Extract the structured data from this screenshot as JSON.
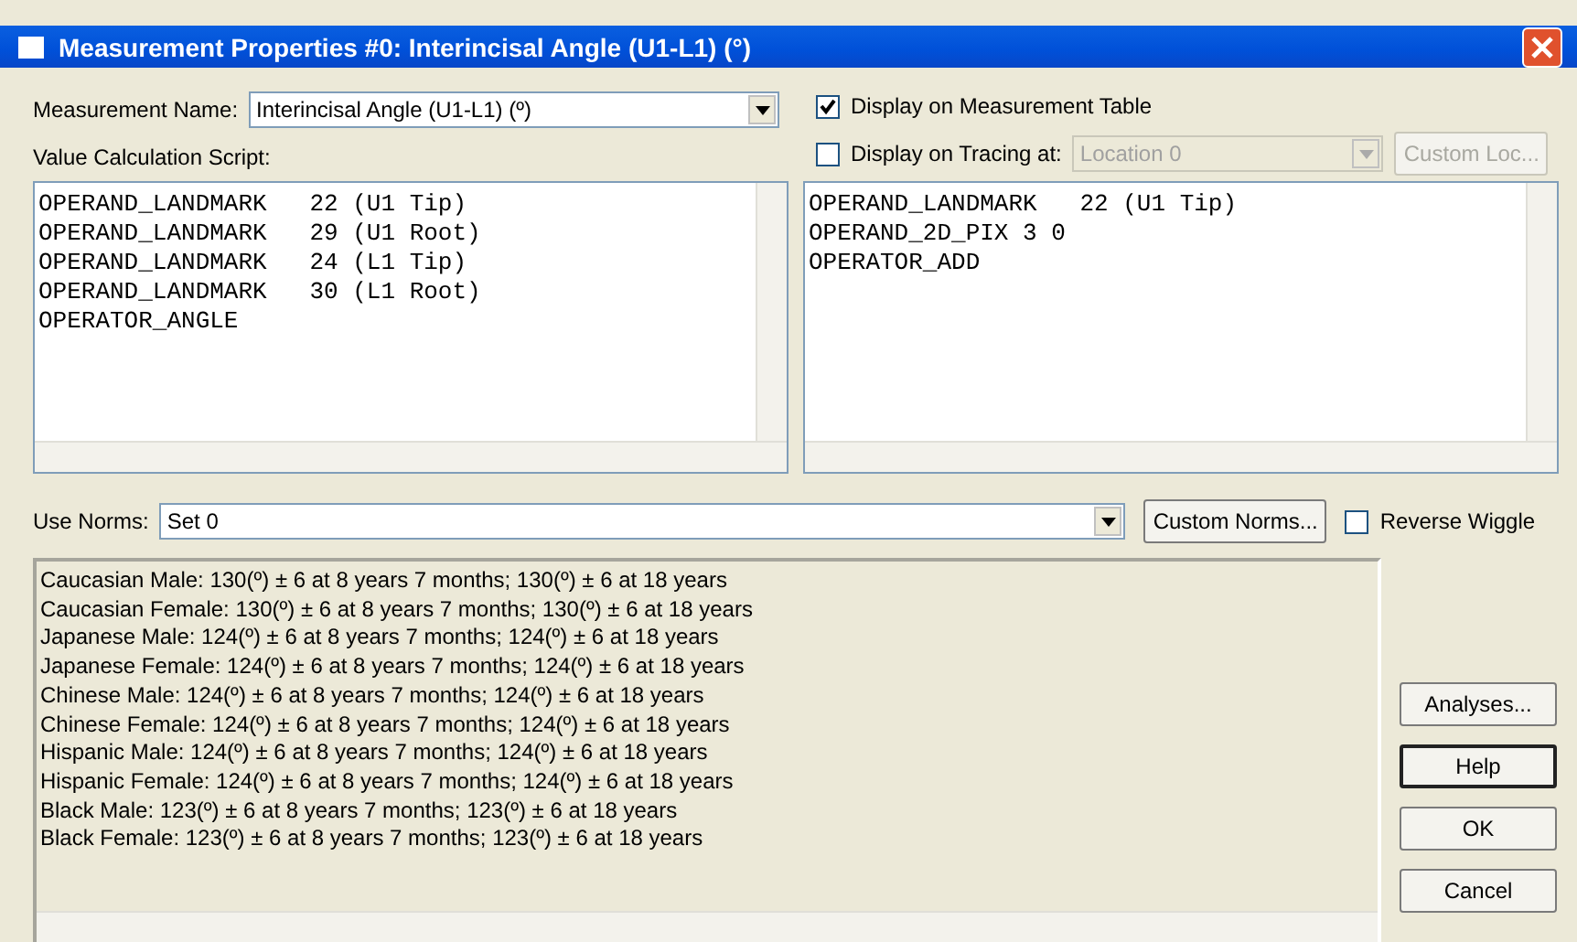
{
  "window": {
    "title": "Measurement Properties #0: Interincisal Angle (U1-L1) (°)"
  },
  "measurement_name": {
    "label": "Measurement Name:",
    "value": "Interincisal Angle (U1-L1) (º)"
  },
  "display_on_table": {
    "label": "Display on Measurement Table",
    "checked": true
  },
  "display_on_tracing": {
    "label": "Display on Tracing at:",
    "checked": false,
    "location": "Location 0",
    "location_disabled": true,
    "custom_button": "Custom Loc...",
    "custom_disabled": true
  },
  "script_label": "Value Calculation Script:",
  "script_left": [
    "OPERAND_LANDMARK   22 (U1 Tip)",
    "OPERAND_LANDMARK   29 (U1 Root)",
    "OPERAND_LANDMARK   24 (L1 Tip)",
    "OPERAND_LANDMARK   30 (L1 Root)",
    "OPERATOR_ANGLE"
  ],
  "script_right": [
    "OPERAND_LANDMARK   22 (U1 Tip)",
    "OPERAND_2D_PIX 3 0",
    "OPERATOR_ADD"
  ],
  "norms": {
    "label": "Use Norms:",
    "value": "Set 0",
    "custom_button": "Custom Norms...",
    "reverse_wiggle": {
      "label": "Reverse Wiggle",
      "checked": false
    }
  },
  "norm_lines": [
    "Caucasian Male: 130(º) ± 6 at 8 years 7 months; 130(º) ± 6 at 18 years",
    "Caucasian Female: 130(º) ± 6 at 8 years 7 months; 130(º) ± 6 at 18 years",
    "Japanese Male: 124(º) ± 6 at 8 years 7 months; 124(º) ± 6 at 18 years",
    "Japanese Female: 124(º) ± 6 at 8 years 7 months; 124(º) ± 6 at 18 years",
    "Chinese Male: 124(º) ± 6 at 8 years 7 months; 124(º) ± 6 at 18 years",
    "Chinese Female: 124(º) ± 6 at 8 years 7 months; 124(º) ± 6 at 18 years",
    "Hispanic Male: 124(º) ± 6 at 8 years 7 months; 124(º) ± 6 at 18 years",
    "Hispanic Female: 124(º) ± 6 at 8 years 7 months; 124(º) ± 6 at 18 years",
    "Black Male: 123(º) ± 6 at 8 years 7 months; 123(º) ± 6 at 18 years",
    "Black Female: 123(º) ± 6 at 8 years 7 months; 123(º) ± 6 at 18 years"
  ],
  "buttons": [
    {
      "label": "Analyses...",
      "default": false
    },
    {
      "label": "Help",
      "default": true
    },
    {
      "label": "OK",
      "default": false
    },
    {
      "label": "Cancel",
      "default": false
    }
  ]
}
